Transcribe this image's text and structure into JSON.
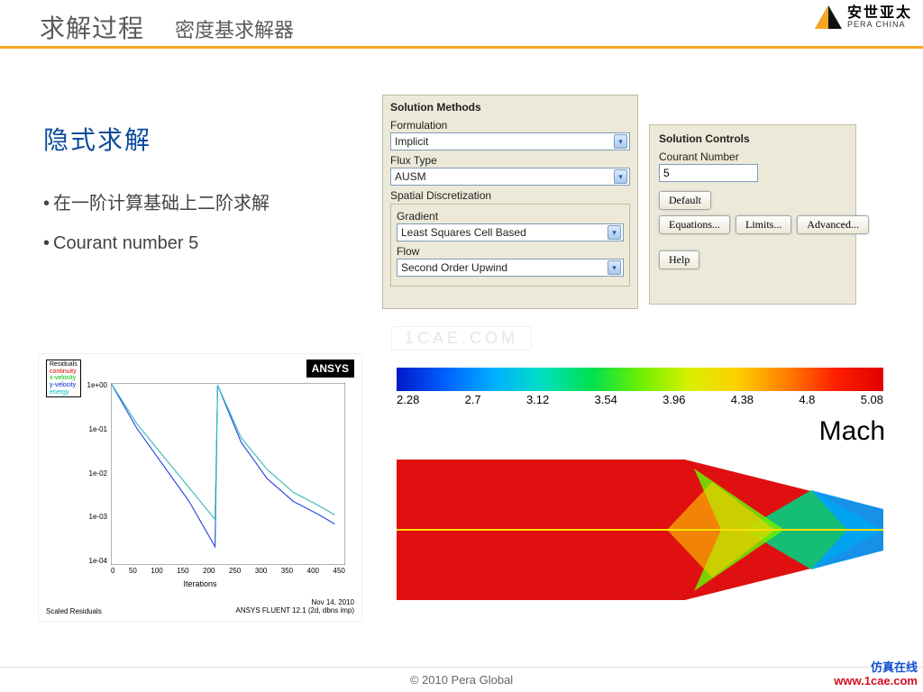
{
  "header": {
    "title": "求解过程",
    "subtitle": "密度基求解器"
  },
  "logo": {
    "cn": "安世亚太",
    "en": "PERA CHINA"
  },
  "section": {
    "heading": "隐式求解"
  },
  "bullets": [
    "在一阶计算基础上二阶求解",
    "Courant number 5"
  ],
  "panel_methods": {
    "title": "Solution Methods",
    "formulation_label": "Formulation",
    "formulation_value": "Implicit",
    "flux_label": "Flux Type",
    "flux_value": "AUSM",
    "spatial_label": "Spatial Discretization",
    "gradient_label": "Gradient",
    "gradient_value": "Least Squares Cell Based",
    "flow_label": "Flow",
    "flow_value": "Second Order Upwind"
  },
  "panel_controls": {
    "title": "Solution Controls",
    "courant_label": "Courant Number",
    "courant_value": "5",
    "btn_default": "Default",
    "btn_equations": "Equations...",
    "btn_limits": "Limits...",
    "btn_advanced": "Advanced...",
    "btn_help": "Help"
  },
  "watermark": "1CAE.COM",
  "chart_data": [
    {
      "type": "line",
      "title": "Scaled Residuals",
      "xlabel": "Iterations",
      "ylabel": "",
      "xlim": [
        0,
        450
      ],
      "ylim_log10": [
        -4,
        0
      ],
      "xticks": [
        0,
        50,
        100,
        150,
        200,
        250,
        300,
        350,
        400,
        450
      ],
      "yticks": [
        "1e+00",
        "1e-01",
        "1e-02",
        "1e-03",
        "1e-04"
      ],
      "legend": [
        "Residuals",
        "continuity",
        "x-velocity",
        "y-velocity",
        "energy"
      ],
      "footer_left": "Scaled Residuals",
      "footer_right_line1": "Nov 14, 2010",
      "footer_right_line2": "ANSYS FLUENT 12.1 (2d, dbns imp)",
      "badge": "ANSYS",
      "series": [
        {
          "name": "continuity",
          "color": "#ff3030",
          "x": [
            0,
            50,
            100,
            150,
            200,
            205,
            250,
            300,
            350,
            400,
            430
          ],
          "y_log10": [
            0,
            -0.9,
            -1.6,
            -2.3,
            -3.0,
            -0.05,
            -1.2,
            -1.9,
            -2.4,
            -2.7,
            -2.9
          ]
        },
        {
          "name": "x-velocity",
          "color": "#30ff30",
          "x": [
            0,
            50,
            100,
            150,
            200,
            205,
            250,
            300,
            350,
            400,
            430
          ],
          "y_log10": [
            0,
            -1.0,
            -1.8,
            -2.6,
            -3.6,
            -0.05,
            -1.3,
            -2.1,
            -2.6,
            -2.9,
            -3.1
          ]
        },
        {
          "name": "y-velocity",
          "color": "#3030ff",
          "x": [
            0,
            50,
            100,
            150,
            200,
            205,
            250,
            300,
            350,
            400,
            430
          ],
          "y_log10": [
            0,
            -1.0,
            -1.8,
            -2.6,
            -3.6,
            -0.05,
            -1.3,
            -2.1,
            -2.6,
            -2.9,
            -3.1
          ]
        },
        {
          "name": "energy",
          "color": "#20d0d0",
          "x": [
            0,
            50,
            100,
            150,
            200,
            205,
            250,
            300,
            350,
            400,
            430
          ],
          "y_log10": [
            0,
            -0.9,
            -1.6,
            -2.3,
            -3.0,
            -0.05,
            -1.2,
            -1.9,
            -2.4,
            -2.7,
            -2.9
          ]
        }
      ]
    },
    {
      "type": "heatmap",
      "label": "Mach",
      "colorbar_min": 2.28,
      "colorbar_max": 5.08,
      "colorbar_ticks": [
        2.28,
        2.7,
        3.12,
        3.54,
        3.96,
        4.38,
        4.8,
        5.08
      ]
    }
  ],
  "footer": "© 2010 Pera Global",
  "stamp": {
    "line1": "仿真在线",
    "line2": "www.1cae.com"
  }
}
